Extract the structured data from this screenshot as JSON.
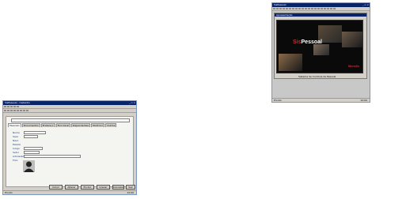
{
  "left_window": {
    "title": "SisPessoal - Cadastro",
    "window_controls": "_ ▫ ×",
    "id_field_value": "",
    "tabs": [
      "Pessoais",
      "Documentos",
      "Endereço",
      "Funcional",
      "Dependentes",
      "Histórico",
      "Outros"
    ],
    "fields": [
      {
        "label": "Nome",
        "value": ""
      },
      {
        "label": "Sexo",
        "value": ""
      },
      {
        "label": "Nasc.",
        "value": ""
      },
      {
        "label": "Estado",
        "value": ""
      },
      {
        "label": "Cargo",
        "value": ""
      },
      {
        "label": "Setor",
        "value": ""
      },
      {
        "label": "Admissão",
        "value": ""
      },
      {
        "label": "Foto",
        "value": ""
      }
    ],
    "buttons": [
      "Incluir",
      "Alterar",
      "Excluir",
      "Gravar",
      "Cancelar",
      "Sair"
    ],
    "status_left": "Pronto",
    "status_right": "12:00"
  },
  "right_window": {
    "title": "SisPessoal",
    "window_controls": "_ ▫ ×",
    "mdi_title": "Apresentação",
    "brand_part1": "Sis",
    "brand_part2": "Pessoal",
    "company": "Morello",
    "caption": "Sistema de Controle de Pessoal",
    "status_left": "Pronto",
    "status_right": "12:00"
  }
}
